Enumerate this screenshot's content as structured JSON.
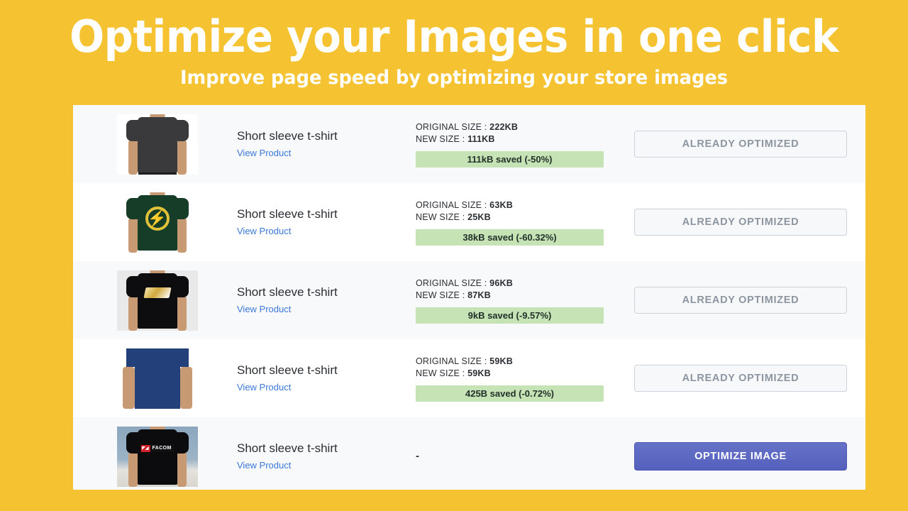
{
  "header": {
    "headline": "Optimize your Images in one click",
    "subhead": "Improve page speed by optimizing your store images"
  },
  "colors": {
    "background": "#f5c231",
    "card": "#ffffff",
    "row_alt": "#f8f9fa",
    "link": "#3b78d8",
    "saved_bar": "#c5e3b4",
    "primary_button": "#5560bd",
    "disabled_button_text": "#8d96a0"
  },
  "labels": {
    "original_size": "ORIGINAL SIZE :",
    "new_size": "NEW SIZE :",
    "view_product": "View Product",
    "already_optimized": "ALREADY OPTIMIZED",
    "optimize_image": "OPTIMIZE IMAGE",
    "empty_stats": "-"
  },
  "rows": [
    {
      "title": "Short sleeve t-shirt",
      "link": "View Product",
      "original_size": "222KB",
      "new_size": "111KB",
      "saved": "111kB saved (-50%)",
      "action": "ALREADY OPTIMIZED",
      "action_state": "disabled",
      "thumb": "dark-gray-tshirt"
    },
    {
      "title": "Short sleeve t-shirt",
      "link": "View Product",
      "original_size": "63KB",
      "new_size": "25KB",
      "saved": "38kB saved (-60.32%)",
      "action": "ALREADY OPTIMIZED",
      "action_state": "disabled",
      "thumb": "green-bolt-tshirt"
    },
    {
      "title": "Short sleeve t-shirt",
      "link": "View Product",
      "original_size": "96KB",
      "new_size": "87KB",
      "saved": "9kB saved (-9.57%)",
      "action": "ALREADY OPTIMIZED",
      "action_state": "disabled",
      "thumb": "black-gold-graphic-tshirt"
    },
    {
      "title": "Short sleeve t-shirt",
      "link": "View Product",
      "original_size": "59KB",
      "new_size": "59KB",
      "saved": "425B saved (-0.72%)",
      "action": "ALREADY OPTIMIZED",
      "action_state": "disabled",
      "thumb": "navy-tshirt"
    },
    {
      "title": "Short sleeve t-shirt",
      "link": "View Product",
      "original_size": null,
      "new_size": null,
      "saved": null,
      "action": "OPTIMIZE IMAGE",
      "action_state": "primary",
      "thumb": "facom-black-tshirt"
    }
  ]
}
